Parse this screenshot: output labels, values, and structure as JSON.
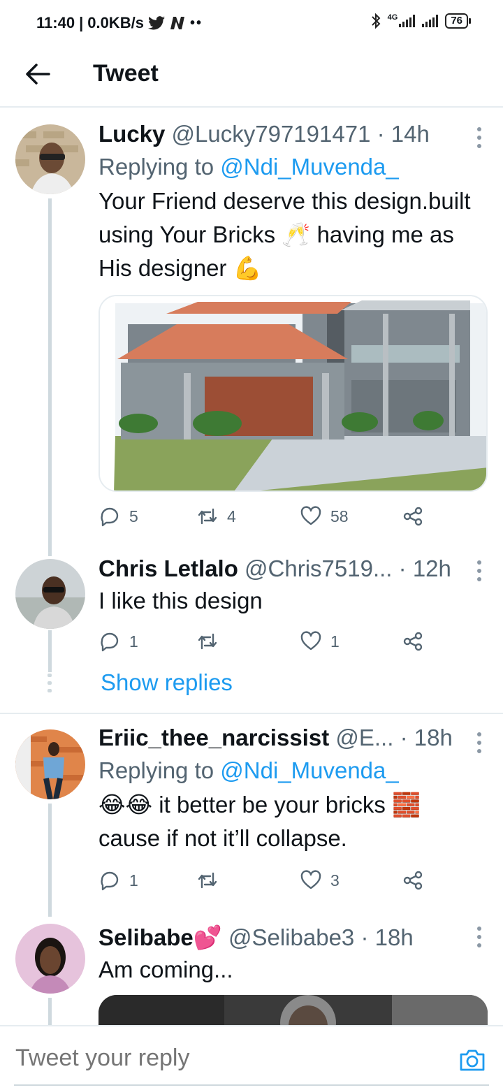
{
  "status_bar": {
    "time": "11:40",
    "speed": "0.0KB/s",
    "battery": "76",
    "network": "4G"
  },
  "header": {
    "title": "Tweet"
  },
  "tweets": [
    {
      "name": "Lucky",
      "handle": "@Lucky797191471",
      "time": "14h",
      "replying_prefix": "Replying to ",
      "replying_to": "@Ndi_Muvenda_",
      "text": "Your Friend deserve this design.built using Your Bricks 🥂 having me as His designer 💪",
      "replies": "5",
      "retweets": "4",
      "likes": "58"
    },
    {
      "name": "Chris Letlalo",
      "handle": "@Chris7519...",
      "time": "12h",
      "text": "I like this design",
      "replies": "1",
      "retweets": "",
      "likes": "1",
      "show_replies": "Show replies"
    },
    {
      "name": "Eriic_thee_narcissist",
      "handle": "@E...",
      "time": "18h",
      "replying_prefix": "Replying to ",
      "replying_to": "@Ndi_Muvenda_",
      "text": "😂😂 it better be your bricks 🧱 cause if not it’ll collapse.",
      "replies": "1",
      "retweets": "",
      "likes": "3"
    },
    {
      "name": "Selibabe💕",
      "handle": "@Selibabe3",
      "time": "18h",
      "text": "Am coming..."
    }
  ],
  "reply_bar": {
    "placeholder": "Tweet your reply"
  },
  "icons": {
    "back": "arrow-left-icon",
    "reply": "speech-bubble-icon",
    "retweet": "retweet-icon",
    "like": "heart-icon",
    "share": "share-icon",
    "more": "more-vertical-icon",
    "camera": "camera-icon"
  },
  "colors": {
    "link": "#1d9bf0",
    "secondary": "#536471"
  }
}
